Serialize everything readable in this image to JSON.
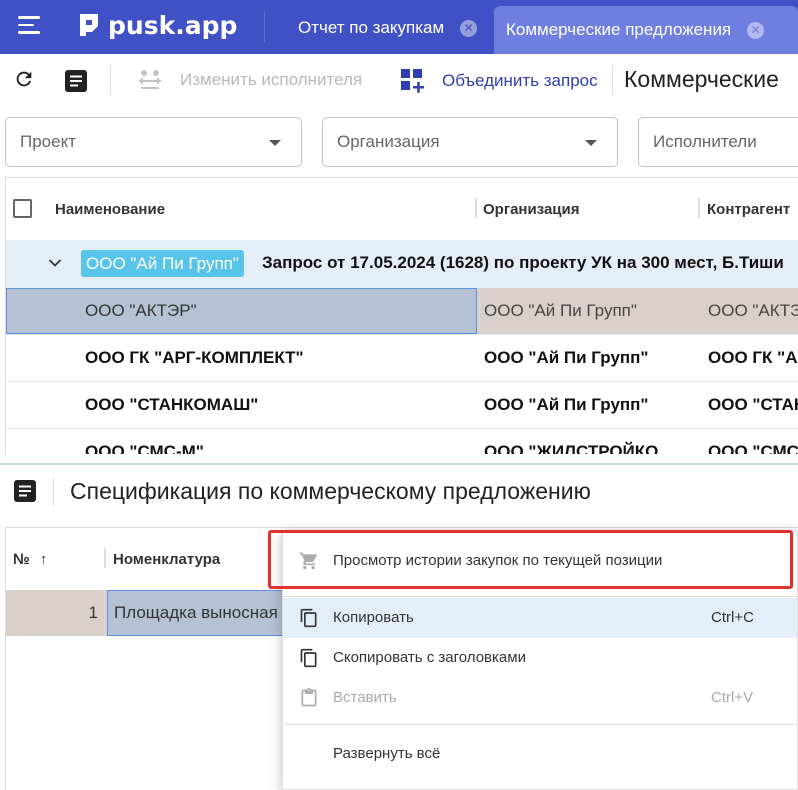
{
  "header": {
    "logo": "pusk.app",
    "tabs": [
      {
        "label": "Отчет по закупкам"
      },
      {
        "label": "Коммерческие предложения"
      }
    ]
  },
  "toolbar": {
    "change_executor": "Изменить исполнителя",
    "merge_request": "Объединить запрос",
    "title": "Коммерческие"
  },
  "filters": [
    {
      "placeholder": "Проект"
    },
    {
      "placeholder": "Организация"
    },
    {
      "placeholder": "Исполнители"
    }
  ],
  "grid": {
    "columns": [
      "Наименование",
      "Организация",
      "Контрагент"
    ],
    "group": {
      "badge": "ООО \"Ай Пи Групп\"",
      "text": "Запрос от 17.05.2024 (1628) по проекту УК на 300 мест, Б.Тиши"
    },
    "rows": [
      {
        "name": "ООО \"АКТЭР\"",
        "org": "ООО \"Ай Пи Групп\"",
        "contractor": "ООО \"АКТЭ"
      },
      {
        "name": "ООО ГК \"АРГ-КОМПЛЕКТ\"",
        "org": "ООО \"Ай Пи Групп\"",
        "contractor": "ООО ГК \"А"
      },
      {
        "name": "ООО \"СТАНКОМАШ\"",
        "org": "ООО \"Ай Пи Групп\"",
        "contractor": "ООО \"СТАН"
      },
      {
        "name": "ООО \"СМС-М\"",
        "org": "ООО \"ЖИЛСТРОЙКО",
        "contractor": "ООО \"СМС"
      }
    ]
  },
  "spec": {
    "title": "Спецификация по коммерческому предложению",
    "columns": [
      "№",
      "Номенклатура"
    ],
    "rows": [
      {
        "num": "1",
        "name": "Площадка выносная"
      }
    ]
  },
  "context_menu": {
    "items": [
      {
        "label": "Просмотр истории закупок по текущей позиции",
        "shortcut": ""
      },
      {
        "label": "Копировать",
        "shortcut": "Ctrl+C"
      },
      {
        "label": "Скопировать с заголовками",
        "shortcut": ""
      },
      {
        "label": "Вставить",
        "shortcut": "Ctrl+V"
      },
      {
        "label": "Развернуть всё",
        "shortcut": ""
      }
    ]
  },
  "colors": {
    "header": "#3f51c4",
    "active_tab": "#6f7fe0",
    "badge": "#58c4ea",
    "group_row": "#e3eef9",
    "selected_cell": "#b5c2d4",
    "org_cell": "#d9cfcb",
    "highlight_border": "#e03030"
  }
}
